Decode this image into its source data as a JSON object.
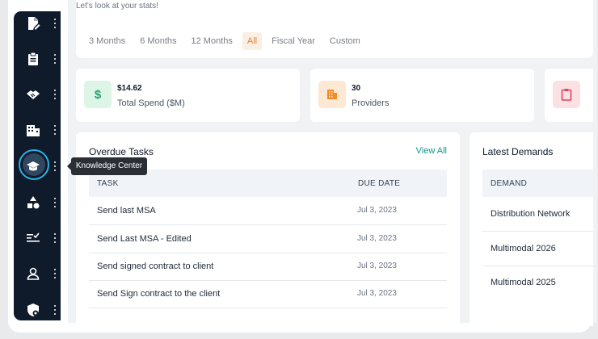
{
  "header": {
    "greeting": "Let's look at your stats!"
  },
  "filters": {
    "tabs": [
      {
        "label": "3 Months",
        "active": false
      },
      {
        "label": "6 Months",
        "active": false
      },
      {
        "label": "12 Months",
        "active": false
      },
      {
        "label": "All",
        "active": true
      },
      {
        "label": "Fiscal Year",
        "active": false
      },
      {
        "label": "Custom",
        "active": false
      }
    ]
  },
  "stats": [
    {
      "value": "$14.62",
      "label": "Total Spend ($M)",
      "icon": "dollar-icon",
      "icon_char": "$",
      "color": "#22a06b",
      "bg": "#dcf5e7"
    },
    {
      "value": "30",
      "label": "Providers",
      "icon": "building-icon",
      "color": "#f08c2a",
      "bg": "#fde8d3"
    },
    {
      "value": "",
      "label": "",
      "icon": "clipboard-icon",
      "color": "#e2445c",
      "bg": "#fbe0e4"
    }
  ],
  "sidebar": {
    "items": [
      {
        "icon": "document-edit-icon"
      },
      {
        "icon": "clipboard-icon"
      },
      {
        "icon": "handshake-icon"
      },
      {
        "icon": "building-icon"
      },
      {
        "icon": "graduation-cap-icon",
        "active": true
      },
      {
        "icon": "shapes-icon"
      },
      {
        "icon": "checklist-icon"
      },
      {
        "icon": "user-icon"
      },
      {
        "icon": "shield-settings-icon"
      }
    ],
    "tooltip": "Knowledge Center"
  },
  "overdue": {
    "title": "Overdue Tasks",
    "view_all": "View All",
    "columns": [
      "TASK",
      "DUE DATE"
    ],
    "rows": [
      {
        "task": "Send last MSA",
        "due": "Jul 3, 2023"
      },
      {
        "task": "Send Last MSA - Edited",
        "due": "Jul 3, 2023"
      },
      {
        "task": "Send signed contract to client",
        "due": "Jul 3, 2023"
      },
      {
        "task": "Send Sign contract to the client",
        "due": "Jul 3, 2023"
      }
    ]
  },
  "demands": {
    "title": "Latest Demands",
    "column": "DEMAND",
    "rows": [
      "Distribution Network",
      "Multimodal 2026",
      "Multimodal 2025"
    ]
  }
}
